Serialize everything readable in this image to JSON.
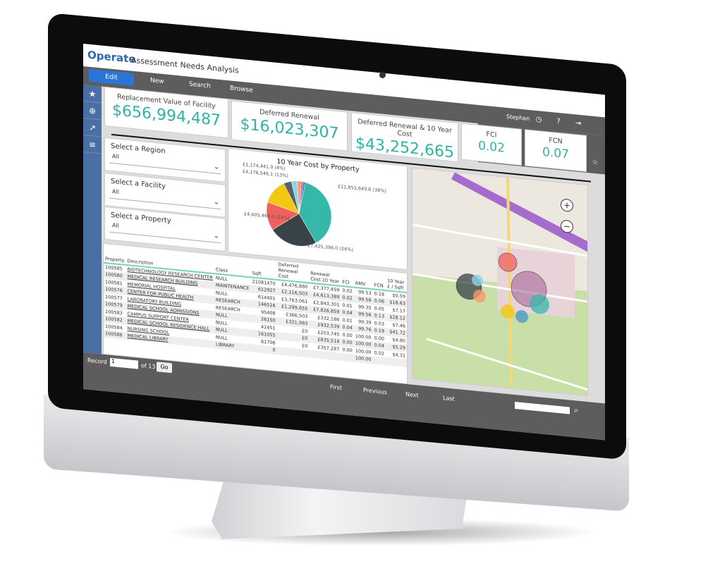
{
  "app": {
    "logo": "Operate",
    "title": "Assessment Needs Analysis"
  },
  "nav": {
    "edit": "Edit",
    "new": "New",
    "search": "Search",
    "browse": "Browse"
  },
  "user": {
    "name": "Stephan",
    "icons": [
      "clock-icon",
      "help-icon",
      "logout-icon",
      "star-icon"
    ]
  },
  "sidebar": {
    "icons": [
      "star-icon",
      "zoom-icon",
      "chart-icon",
      "list-icon"
    ]
  },
  "kpis": [
    {
      "label": "Replacement Value of Facility",
      "value": "$656,994,487"
    },
    {
      "label": "Deferred Renewal",
      "value": "$16,023,307"
    },
    {
      "label": "Deferred Renewal & 10 Year Cost",
      "value": "$43,252,665"
    },
    {
      "label": "FCI",
      "value": "0.02"
    },
    {
      "label": "FCN",
      "value": "0.07"
    }
  ],
  "kpi_color": "#2eb3a3",
  "filters": [
    {
      "label": "Select a Region",
      "value": "All"
    },
    {
      "label": "Select a Facility",
      "value": "All"
    },
    {
      "label": "Select a Property",
      "value": "All"
    }
  ],
  "chart_data": {
    "type": "pie",
    "title": "10 Year Cost by Property",
    "slices": [
      {
        "value": 38,
        "color": "#35b8a8",
        "label": "£11,853,649.6 (38%)"
      },
      {
        "value": 24,
        "color": "#374349",
        "label": "£7,425,398.0 (24%)"
      },
      {
        "value": 14,
        "color": "#f0605c",
        "label": "£4,405,469.0 (14%)"
      },
      {
        "value": 13,
        "color": "#f2c811",
        "label": "£4,176,546.1 (13%)"
      },
      {
        "value": 4,
        "color": "#5a6268",
        "label": "£1,174,441.9 (4%)"
      },
      {
        "value": 3,
        "color": "#8ad4eb",
        "label": ""
      },
      {
        "value": 2,
        "color": "#fe9666",
        "label": ""
      },
      {
        "value": 1,
        "color": "#a66999",
        "label": ""
      },
      {
        "value": 1,
        "color": "#3a6fc4",
        "label": ""
      }
    ]
  },
  "table": {
    "headers": [
      "Property",
      "Description",
      "Class",
      "Sqft",
      "Deferred Renewal Cost",
      "Renewal Cost 10 Year",
      "FCI",
      "RMV",
      "FCN",
      "10 Year £ / Sqft"
    ],
    "rows": [
      [
        "100585",
        "BIOTECHNOLOGY RESEARCH CENTER",
        "NULL",
        "21081470",
        "£4,476,880",
        "£7,377,459",
        "0.02",
        "99.53",
        "0.18",
        "$0.59"
      ],
      [
        "100580",
        "MEDICAL RESEARCH BUILDING",
        "MAINTENANCE",
        "612927",
        "£2,116,503",
        "£4,613,389",
        "0.02",
        "99.56",
        "0.06",
        "$18.63"
      ],
      [
        "100581",
        "MEMORIAL HOSPITAL",
        "NULL",
        "614401",
        "£3,763,061",
        "£2,843,301",
        "0.01",
        "99.35",
        "0.05",
        "$7.17"
      ],
      [
        "100576",
        "CENTER FOR PUBLIC HEALTH",
        "RESEARCH",
        "146516",
        "£1,299,655",
        "£7,826,859",
        "0.04",
        "99.56",
        "0.13",
        "$28.12"
      ],
      [
        "100577",
        "LABORATORY BUILDING",
        "RESEARCH",
        "95408",
        "£366,503",
        "£332,186",
        "0.01",
        "99.39",
        "0.03",
        "$7.46"
      ],
      [
        "100579",
        "MEDICAL SCHOOL ADMISSIONS",
        "NULL",
        "26150",
        "£321,993",
        "£932,539",
        "0.04",
        "99.76",
        "0.19",
        "$41.72"
      ],
      [
        "100583",
        "CAMPUS SUPPORT CENTER",
        "NULL",
        "42451",
        "£0",
        "£203,745",
        "0.00",
        "100.00",
        "0.00",
        "$4.80"
      ],
      [
        "100582",
        "MEDICAL SCHOOL RESIDENCE HALL",
        "NULL",
        "161055",
        "£0",
        "£835,514",
        "0.00",
        "100.00",
        "0.04",
        "$5.29"
      ],
      [
        "100584",
        "NURSING SCHOOL",
        "NULL",
        "81706",
        "£0",
        "£357,287",
        "0.00",
        "100.00",
        "0.02",
        "$4.31"
      ],
      [
        "100586",
        "MEDICAL LIBRARY",
        "LIBRARY",
        "0",
        "",
        "",
        "",
        "100.00",
        "",
        ""
      ]
    ]
  },
  "footer": {
    "record_label": "Record",
    "record_value": "1",
    "of_label": "of 13",
    "go": "Go",
    "first": "First",
    "previous": "Previous",
    "next": "Next",
    "last": "Last"
  },
  "map": {
    "zoom_in": "+",
    "zoom_out": "−"
  }
}
